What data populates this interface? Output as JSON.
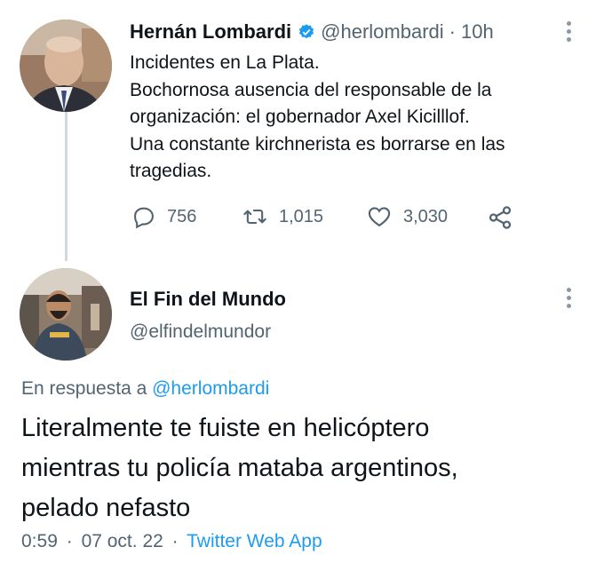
{
  "tweet1": {
    "author_name": "Hernán Lombardi",
    "handle": "@herlombardi",
    "separator": "·",
    "time": "10h",
    "text": "Incidentes en La Plata.\nBochornosa ausencia del responsable de la organización: el gobernador Axel Kicilllof.\nUna constante kirchnerista es borrarse en las tragedias.",
    "replies": "756",
    "retweets": "1,015",
    "likes": "3,030"
  },
  "tweet2": {
    "author_name": "El Fin del Mundo",
    "handle": "@elfindelmundor",
    "reply_prefix": "En respuesta a",
    "reply_to": "@herlombardi",
    "text": "Literalmente te fuiste en helicóptero\nmientras tu policía mataba argentinos,\npelado nefasto",
    "time": "0:59",
    "sep1": "·",
    "date": "07 oct. 22",
    "sep2": "·",
    "source": "Twitter Web App"
  },
  "colors": {
    "link": "#1d9bf0",
    "muted": "#536471",
    "text": "#0f1419",
    "thread_line": "#cfd9de"
  },
  "icons": [
    "verified-badge-icon",
    "reply-icon",
    "retweet-icon",
    "like-icon",
    "share-icon",
    "more-icon"
  ]
}
